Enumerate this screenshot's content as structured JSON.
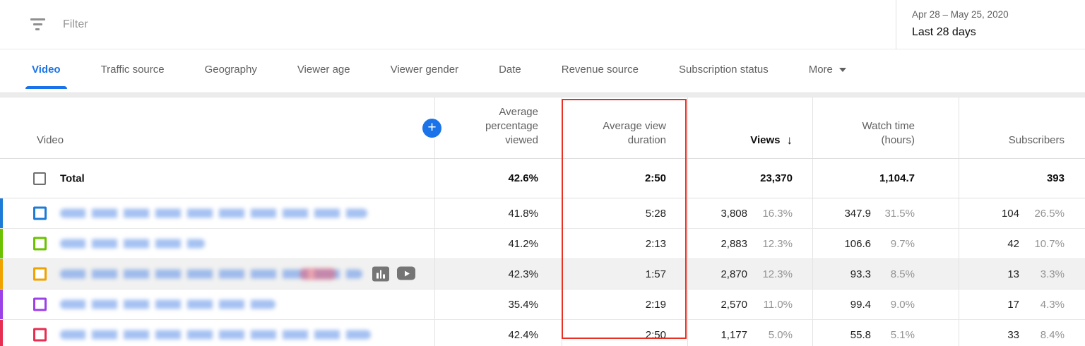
{
  "filter_bar": {
    "placeholder": "Filter"
  },
  "date_panel": {
    "range": "Apr 28 – May 25, 2020",
    "label": "Last 28 days"
  },
  "tabs": {
    "items": [
      "Video",
      "Traffic source",
      "Geography",
      "Viewer age",
      "Viewer gender",
      "Date",
      "Revenue source",
      "Subscription status"
    ],
    "active": "Video",
    "more_label": "More"
  },
  "icons": {
    "sort_desc": "↓",
    "add_metric": "+"
  },
  "table": {
    "columns": {
      "video": "Video",
      "avg_pct": "Average percentage viewed",
      "avg_dur": "Average view duration",
      "views": "Views",
      "watch": "Watch time (hours)",
      "subs": "Subscribers"
    },
    "sorted_column": "Views",
    "total": {
      "label": "Total",
      "avg_pct": "42.6%",
      "avg_dur": "2:50",
      "views": "23,370",
      "watch": "1,104.7",
      "subs": "393"
    },
    "rows": [
      {
        "color": "#1d7bd8",
        "avg_pct": "41.8%",
        "avg_dur": "5:28",
        "views": "3,808",
        "views_pct": "16.3%",
        "watch": "347.9",
        "watch_pct": "31.5%",
        "subs": "104",
        "subs_pct": "26.5%"
      },
      {
        "color": "#6bc200",
        "avg_pct": "41.2%",
        "avg_dur": "2:13",
        "views": "2,883",
        "views_pct": "12.3%",
        "watch": "106.6",
        "watch_pct": "9.7%",
        "subs": "42",
        "subs_pct": "10.7%"
      },
      {
        "color": "#f0a200",
        "avg_pct": "42.3%",
        "avg_dur": "1:57",
        "views": "2,870",
        "views_pct": "12.3%",
        "watch": "93.3",
        "watch_pct": "8.5%",
        "subs": "13",
        "subs_pct": "3.3%"
      },
      {
        "color": "#9c40e8",
        "avg_pct": "35.4%",
        "avg_dur": "2:19",
        "views": "2,570",
        "views_pct": "11.0%",
        "watch": "99.4",
        "watch_pct": "9.0%",
        "subs": "17",
        "subs_pct": "4.3%"
      },
      {
        "color": "#e62e52",
        "avg_pct": "42.4%",
        "avg_dur": "2:50",
        "views": "1,177",
        "views_pct": "5.0%",
        "watch": "55.8",
        "watch_pct": "5.1%",
        "subs": "33",
        "subs_pct": "8.4%"
      }
    ]
  },
  "annotation": {
    "highlighted_column": "Average view duration",
    "box_color": "#e93025"
  }
}
